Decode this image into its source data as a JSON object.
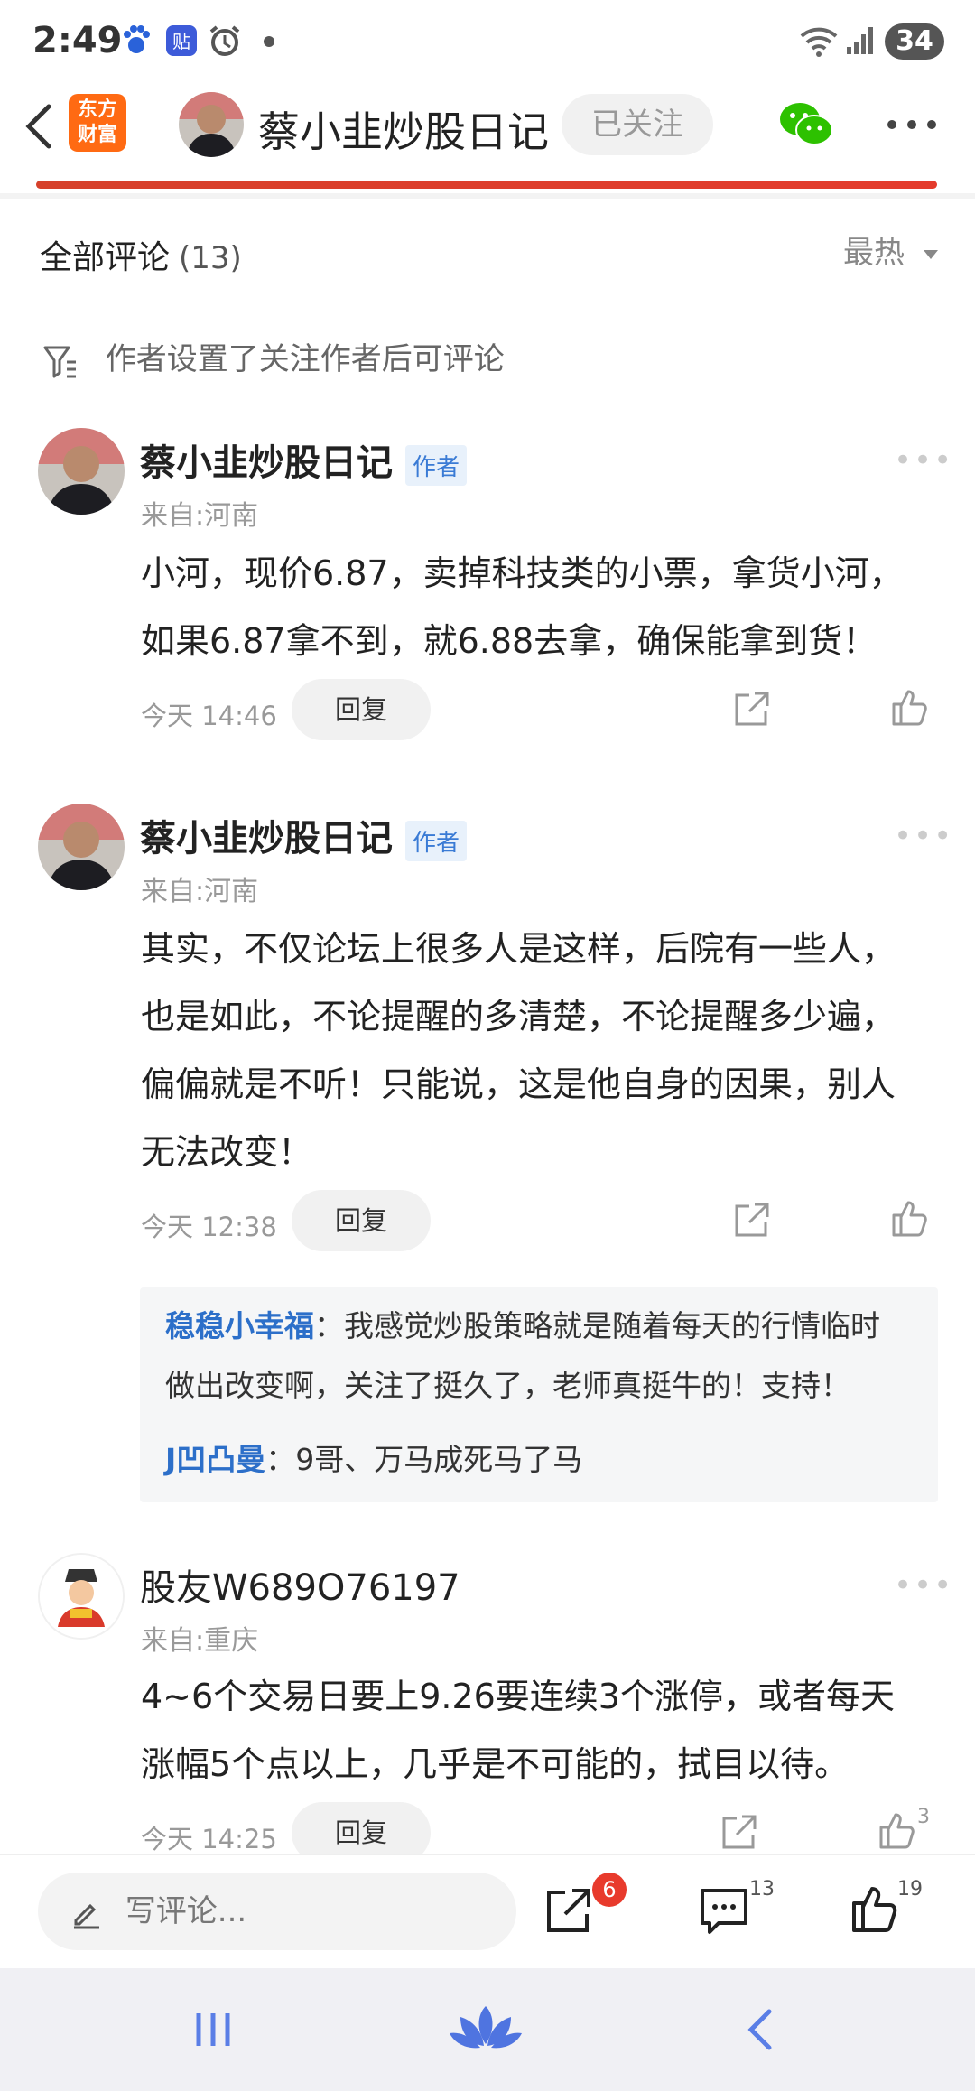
{
  "status_bar": {
    "time": "2:49",
    "battery": "34"
  },
  "header": {
    "logo_line1": "东方",
    "logo_line2": "财富",
    "title": "蔡小韭炒股日记",
    "follow_label": "已关注"
  },
  "comments_header": {
    "label": "全部评论",
    "count": "(13)",
    "sort": "最热"
  },
  "notice": "作者设置了关注作者后可评论",
  "comments": [
    {
      "user": "蔡小韭炒股日记",
      "tag": "作者",
      "location": "来自:河南",
      "text": "小河，现价6.87，卖掉科技类的小票，拿货小河，\n如果6.87拿不到，就6.88去拿，确保能拿到货！",
      "time": "今天 14:46",
      "reply_label": "回复"
    },
    {
      "user": "蔡小韭炒股日记",
      "tag": "作者",
      "location": "来自:河南",
      "text": "其实，不仅论坛上很多人是这样，后院有一些人，\n也是如此，不论提醒的多清楚，不论提醒多少遍，\n偏偏就是不听！只能说，这是他自身的因果，别人\n无法改变！",
      "time": "今天 12:38",
      "reply_label": "回复",
      "replies": [
        {
          "user": "稳稳小幸福",
          "text": "：我感觉炒股策略就是随着每天的行情临时",
          "text2": "做出改变啊，关注了挺久了，老师真挺牛的！支持！"
        },
        {
          "user": "J凹凸曼",
          "text": "：9哥、万马成死马了马"
        }
      ]
    },
    {
      "user": "股友W689O76197",
      "location": "来自:重庆",
      "text": "4~6个交易日要上9.26要连续3个涨停，或者每天\n涨幅5个点以上，几乎是不可能的，拭目以待。",
      "time": "今天 14:25",
      "reply_label": "回复",
      "like_count": "3"
    }
  ],
  "bottom_bar": {
    "write_placeholder": "写评论...",
    "share_badge": "6",
    "comment_count": "13",
    "like_count": "19"
  },
  "colors": {
    "brand": "#ff6a13",
    "accent_blue": "#2c6fc9",
    "red": "#e43b2c"
  }
}
